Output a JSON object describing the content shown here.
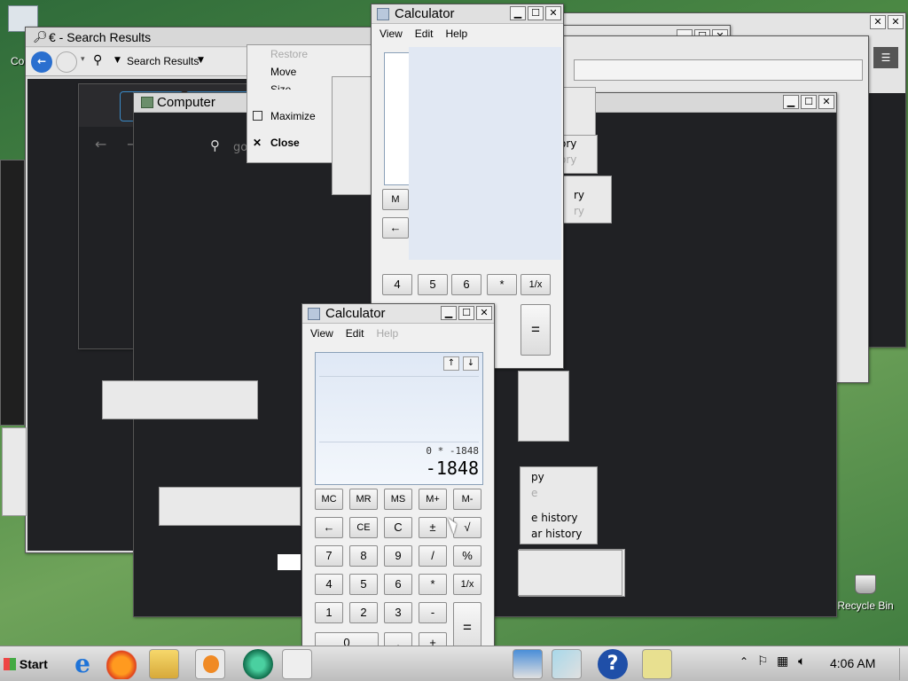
{
  "browser": {
    "title": "€ - Search Results",
    "search_label": "Search Results"
  },
  "context_menu": {
    "items": [
      {
        "label": "Restore",
        "disabled": true
      },
      {
        "label": "Move",
        "disabled": false
      },
      {
        "label": "Size",
        "disabled": false
      },
      {
        "label": "Maximize",
        "disabled": false
      },
      {
        "label": "Close",
        "disabled": false
      }
    ]
  },
  "computer_window": {
    "title": "Computer",
    "address_text": "go"
  },
  "calc_back": {
    "title": "Calculator",
    "menu": [
      "View",
      "Edit",
      "Help"
    ],
    "visible_buttons": [
      [
        "4",
        "5",
        "6",
        "*",
        "1/x"
      ]
    ],
    "equals": "=",
    "partial_labels": [
      "M",
      "←"
    ]
  },
  "calc_front": {
    "title": "Calculator",
    "menu": [
      {
        "label": "View",
        "disabled": false
      },
      {
        "label": "Edit",
        "disabled": false
      },
      {
        "label": "Help",
        "disabled": true
      }
    ],
    "expression": "0 * -1848",
    "value": "-1848",
    "rows": [
      [
        "MC",
        "MR",
        "MS",
        "M+",
        "M-"
      ],
      [
        "←",
        "CE",
        "C",
        "±",
        "√"
      ],
      [
        "7",
        "8",
        "9",
        "/",
        "%"
      ],
      [
        "4",
        "5",
        "6",
        "*",
        "1/x"
      ],
      [
        "1",
        "2",
        "3",
        "-"
      ]
    ],
    "zero": "0",
    "dot": ".",
    "plus": "+",
    "equals": "="
  },
  "history_menu": {
    "items": [
      "py",
      "e",
      "e history",
      "ar history"
    ]
  },
  "back_history_menu": {
    "items": [
      "ory",
      "ory",
      "ry",
      "ry"
    ]
  },
  "desktop": {
    "recycle_bin": "Recycle Bin",
    "computer_icon_label": "Co"
  },
  "taskbar": {
    "start": "Start",
    "clock": "4:06 AM"
  }
}
